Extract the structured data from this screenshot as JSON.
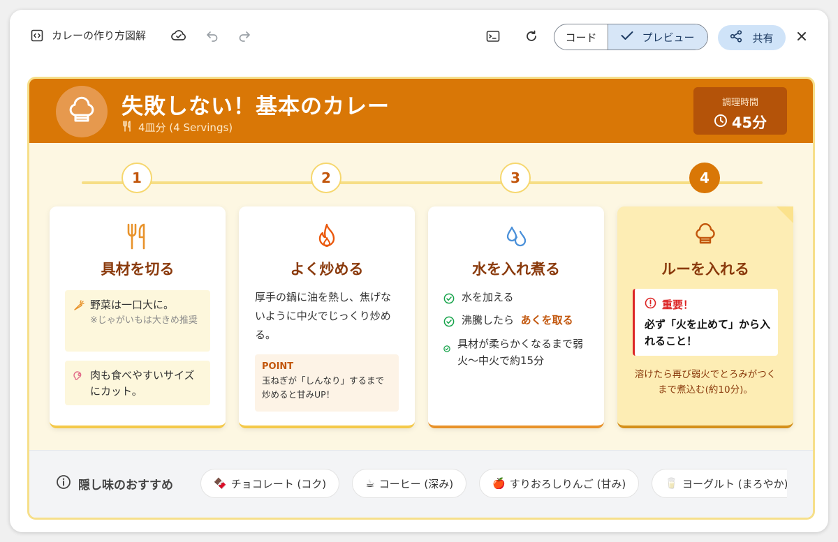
{
  "toolbar": {
    "title": "カレーの作り方図解",
    "code_label": "コード",
    "preview_label": "プレビュー",
    "share_label": "共有"
  },
  "header": {
    "title": "失敗しない！基本のカレー",
    "servings": "4皿分 (4 Servings)",
    "time_label": "調理時間",
    "time_value": "45分"
  },
  "steps": [
    {
      "number": "1",
      "icon": "utensils-icon",
      "title": "具材を切る",
      "tips": [
        {
          "icon": "carrot-icon",
          "text": "野菜は一口大に。",
          "note": "※じゃがいもは大きめ推奨"
        },
        {
          "icon": "meat-icon",
          "text": "肉も食べやすいサイズにカット。"
        }
      ]
    },
    {
      "number": "2",
      "icon": "flame-icon",
      "title": "よく炒める",
      "body": "厚手の鍋に油を熱し、焦げないように中火でじっくり炒める。",
      "point_label": "POINT",
      "point_text": "玉ねぎが「しんなり」するまで炒めると甘みUP！"
    },
    {
      "number": "3",
      "icon": "droplets-icon",
      "title": "水を入れ煮る",
      "checks": [
        {
          "text": "水を加える"
        },
        {
          "text": "沸騰したら",
          "highlight": "あくを取る"
        },
        {
          "text": "具材が柔らかくなるまで弱火〜中火で約15分"
        }
      ]
    },
    {
      "number": "4",
      "icon": "chef-hat-icon",
      "title": "ルーを入れる",
      "warning_title": "重要！",
      "warning_text": "必ず「火を止めて」から入れること！",
      "after_text": "溶けたら再び弱火でとろみがつくまで煮込む(約10分)。"
    }
  ],
  "footer": {
    "label": "隠し味のおすすめ",
    "chips": [
      {
        "emoji": "🍫",
        "text": "チョコレート (コク)"
      },
      {
        "emoji": "☕",
        "text": "コーヒー (深み)"
      },
      {
        "emoji": "🍎",
        "text": "すりおろしりんご (甘み)"
      },
      {
        "emoji": "🥛",
        "text": "ヨーグルト (まろやか)"
      }
    ]
  },
  "colors": {
    "accent": "#d97706",
    "accent_dark": "#b45309",
    "title_brown": "#8a3a0c",
    "warning_red": "#dc2626",
    "check_green": "#16a34a",
    "preview_blue": "#d7e6f7"
  }
}
